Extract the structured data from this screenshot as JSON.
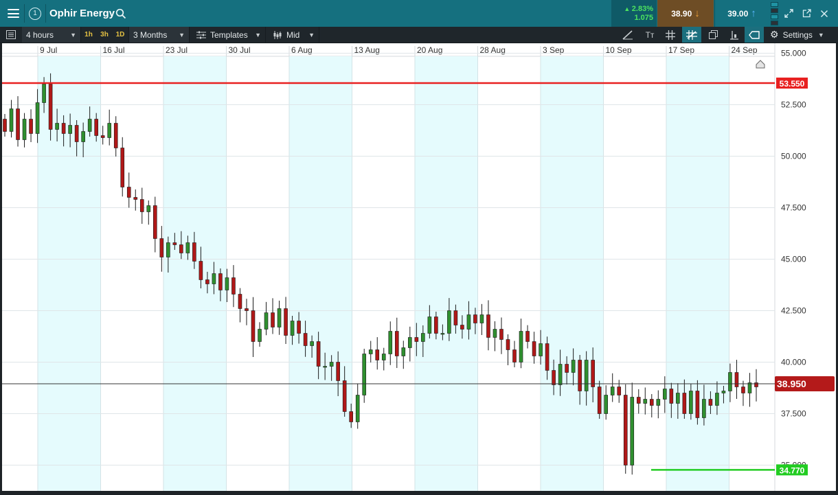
{
  "header": {
    "instrument": "Ophir Energy",
    "info_number": "1",
    "change_pct": "2.83%",
    "change_abs": "1.075",
    "sell_price": "38.90",
    "buy_price": "39.00"
  },
  "toolbar": {
    "interval": "4 hours",
    "quick_intervals": [
      "1h",
      "3h",
      "1D"
    ],
    "range": "3 Months",
    "templates": "Templates",
    "price_type": "Mid",
    "settings": "Settings"
  },
  "colors": {
    "header_bg": "#15707f",
    "up_candle": "#2f8f2f",
    "down_candle": "#b01818",
    "resistance_line": "#e82020",
    "support_line": "#22cc22",
    "current_price_badge": "#b41a1a",
    "weekday_band": "#e5fbfd"
  },
  "chart_data": {
    "type": "candlestick",
    "x_ticks": [
      "9 Jul",
      "16 Jul",
      "23 Jul",
      "30 Jul",
      "6 Aug",
      "13 Aug",
      "20 Aug",
      "28 Aug",
      "3 Sep",
      "10 Sep",
      "17 Sep",
      "24 Sep"
    ],
    "y_ticks": [
      "55.000",
      "52.500",
      "50.000",
      "47.500",
      "45.000",
      "42.500",
      "40.000",
      "37.500",
      "35.000"
    ],
    "ylim": [
      35.0,
      55.0
    ],
    "horizontal_lines": [
      {
        "label": "53.550",
        "value": 53.55,
        "role": "resistance"
      },
      {
        "label": "34.770",
        "value": 34.77,
        "role": "support"
      }
    ],
    "current_price": {
      "label": "38.950",
      "value": 38.95
    },
    "closes": [
      51.2,
      52.3,
      50.8,
      51.8,
      51.1,
      52.6,
      53.5,
      51.3,
      51.6,
      51.1,
      51.5,
      50.7,
      51.2,
      51.8,
      51.0,
      50.9,
      51.6,
      50.4,
      48.5,
      48.0,
      47.9,
      47.3,
      47.6,
      46.0,
      45.1,
      45.8,
      45.7,
      45.3,
      45.8,
      44.9,
      44.0,
      43.8,
      44.3,
      43.5,
      44.1,
      43.3,
      42.6,
      42.5,
      41.0,
      41.6,
      42.4,
      41.7,
      42.6,
      41.3,
      42.0,
      41.4,
      40.8,
      41.0,
      39.8,
      39.8,
      40.0,
      39.1,
      37.6,
      37.1,
      38.4,
      40.4,
      40.6,
      40.1,
      40.4,
      41.5,
      40.3,
      40.7,
      41.2,
      41.0,
      41.4,
      42.2,
      41.4,
      41.4,
      42.5,
      41.8,
      41.6,
      42.3,
      41.9,
      42.3,
      41.2,
      41.6,
      41.1,
      40.6,
      40.0,
      41.5,
      41.0,
      40.3,
      40.9,
      39.6,
      38.9,
      39.9,
      39.5,
      40.1,
      38.6,
      40.1,
      38.8,
      37.5,
      38.4,
      38.8,
      38.4,
      35.0,
      38.3,
      38.0,
      38.2,
      37.9,
      38.2,
      38.7,
      38.0,
      38.5,
      37.5,
      38.6,
      37.3,
      38.2,
      37.9,
      38.5,
      38.6,
      39.5,
      38.8,
      38.5,
      39.0,
      38.8
    ]
  }
}
